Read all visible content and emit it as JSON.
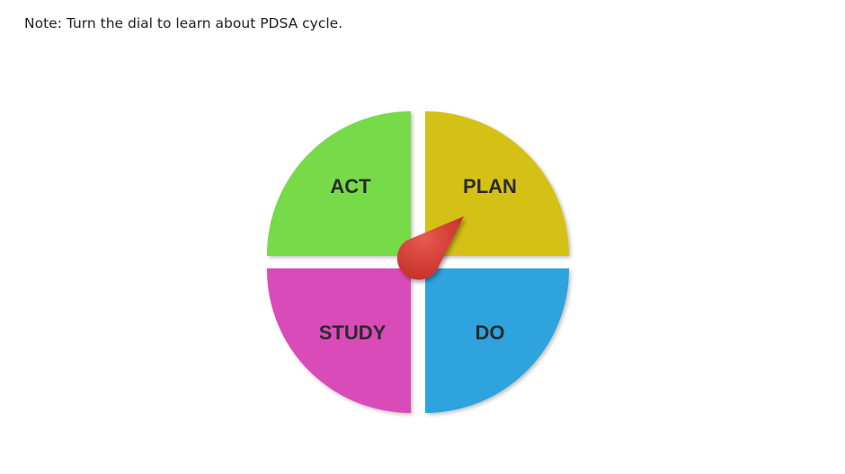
{
  "note": "Note: Turn the dial to learn about PDSA cycle.",
  "dial": {
    "quadrants": [
      {
        "id": "plan",
        "label": "PLAN",
        "color": "#d5c014"
      },
      {
        "id": "do",
        "label": "DO",
        "color": "#2fa3de"
      },
      {
        "id": "study",
        "label": "STUDY",
        "color": "#d94cb9"
      },
      {
        "id": "act",
        "label": "ACT",
        "color": "#77da49"
      }
    ],
    "pointer": {
      "color": "#d93b34",
      "pointing_to": "PLAN"
    }
  },
  "icons": {
    "pointer": "dial-pointer-icon"
  }
}
